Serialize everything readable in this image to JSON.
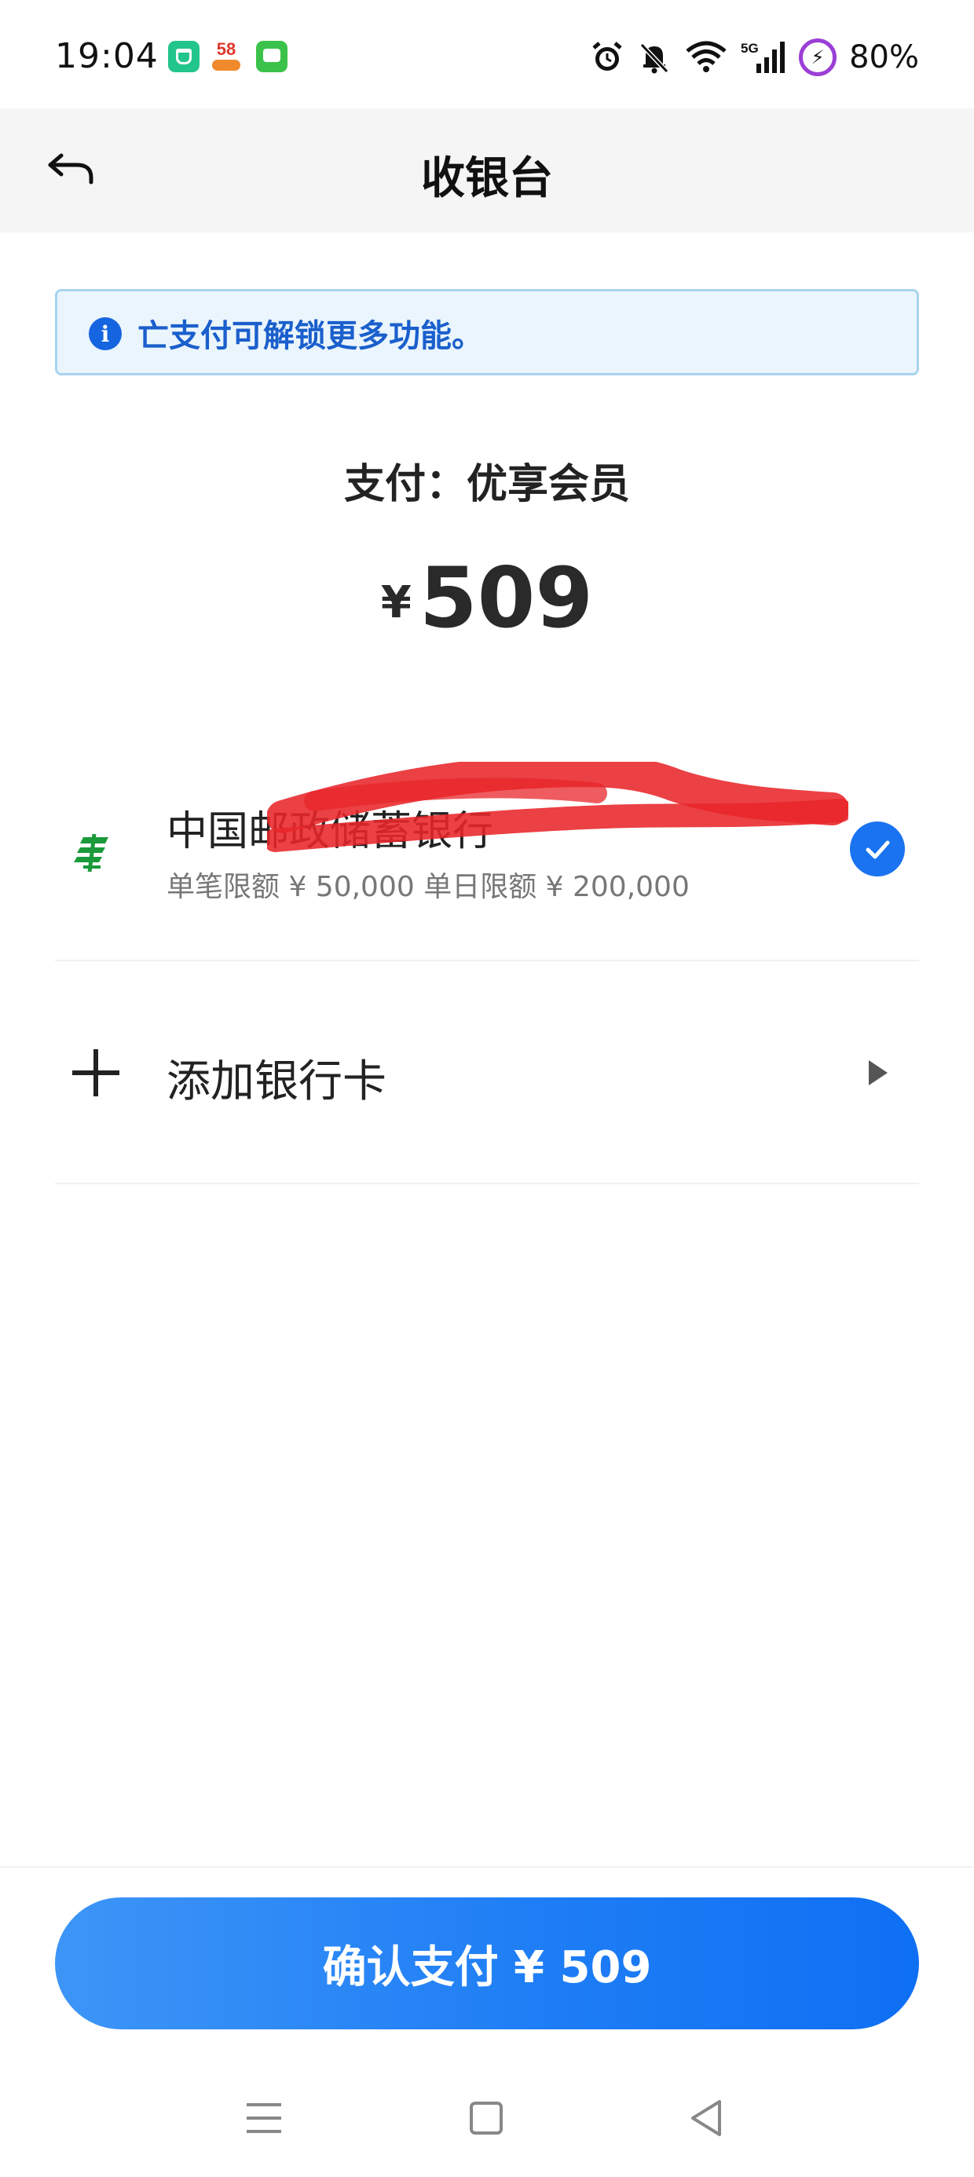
{
  "status_bar": {
    "time": "19:04",
    "app_icons": [
      "mi-home-icon",
      "58-app-icon",
      "messages-icon"
    ],
    "app_58_label": "58",
    "system_icons": [
      "alarm-icon",
      "mute-icon",
      "wifi-icon",
      "5g-signal-icon",
      "battery-icon"
    ],
    "network": "5G",
    "battery": "80%"
  },
  "header": {
    "title": "收银台",
    "back_icon": "back-arrow-icon"
  },
  "notice": {
    "icon": "info-icon",
    "icon_glyph": "i",
    "text": "亡支付可解锁更多功能。"
  },
  "payment": {
    "title": "支付：优享会员",
    "currency": "¥",
    "amount": "509"
  },
  "bank_card": {
    "logo": "postal-savings-bank-icon",
    "name": "中国邮政储蓄银行",
    "limits": "单笔限额 ¥ 50,000 单日限额 ¥ 200,000",
    "selected": true
  },
  "add_card": {
    "icon": "plus-icon",
    "label": "添加银行卡",
    "arrow_icon": "arrow-right-icon"
  },
  "confirm": {
    "label": "确认支付 ¥ 509"
  },
  "nav": {
    "items": [
      "menu-icon",
      "home-icon",
      "back-icon"
    ]
  },
  "colors": {
    "accent": "#1a73f0",
    "notice_bg": "#eaf5fd",
    "notice_text": "#1a5fcc",
    "header_bg": "#f5f5f5",
    "bank_green": "#1a9a3a",
    "redaction": "#e8262a"
  }
}
